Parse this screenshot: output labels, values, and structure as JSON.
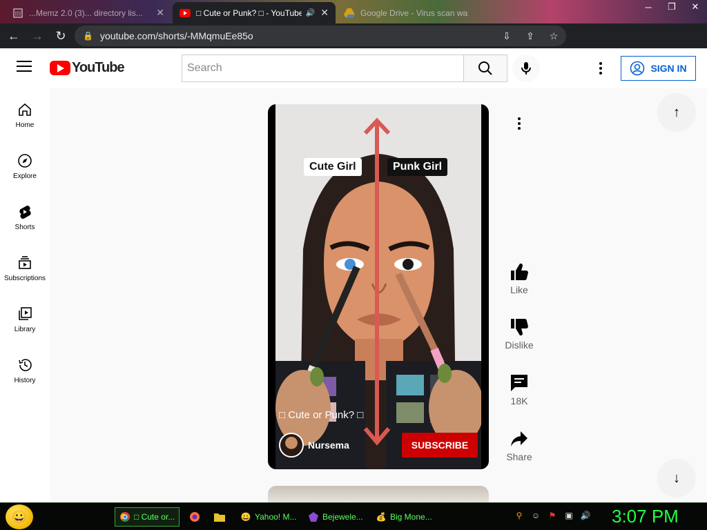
{
  "browser": {
    "tabs": [
      {
        "title": "...Memz 2.0 (3)... directory lis...",
        "active": false
      },
      {
        "title": "□ Cute or Punk? □ - YouTube",
        "active": true
      },
      {
        "title": "Google Drive - Virus scan warni...",
        "active": false
      }
    ],
    "url": "youtube.com/shorts/-MMqmuEe85o"
  },
  "youtube": {
    "logo_text": "YouTube",
    "search_placeholder": "Search",
    "sign_in_label": "SIGN IN",
    "guide": [
      {
        "label": "Home",
        "icon": "home-icon"
      },
      {
        "label": "Explore",
        "icon": "compass-icon"
      },
      {
        "label": "Shorts",
        "icon": "shorts-icon"
      },
      {
        "label": "Subscriptions",
        "icon": "subscriptions-icon"
      },
      {
        "label": "Library",
        "icon": "library-icon"
      },
      {
        "label": "History",
        "icon": "history-icon"
      }
    ]
  },
  "short": {
    "overlay_left": "Cute Girl",
    "overlay_right": "Punk Girl",
    "caption": "□ Cute or Punk? □",
    "channel": "Nursema",
    "subscribe_label": "SUBSCRIBE"
  },
  "actions": {
    "like": "Like",
    "dislike": "Dislike",
    "comments": "18K",
    "share": "Share"
  },
  "taskbar": {
    "items": [
      {
        "label": "□ Cute or...",
        "active": true
      },
      {
        "label": "",
        "active": false
      },
      {
        "label": "",
        "active": false
      },
      {
        "label": "Yahoo! M...",
        "active": false
      },
      {
        "label": "Bejewele...",
        "active": false
      },
      {
        "label": "Big Mone...",
        "active": false
      }
    ],
    "clock": "3:07 PM"
  },
  "colors": {
    "youtube_red": "#ff0000",
    "subscribe_red": "#cc0000",
    "signin_blue": "#065fd4",
    "clock_green": "#22ff44"
  }
}
